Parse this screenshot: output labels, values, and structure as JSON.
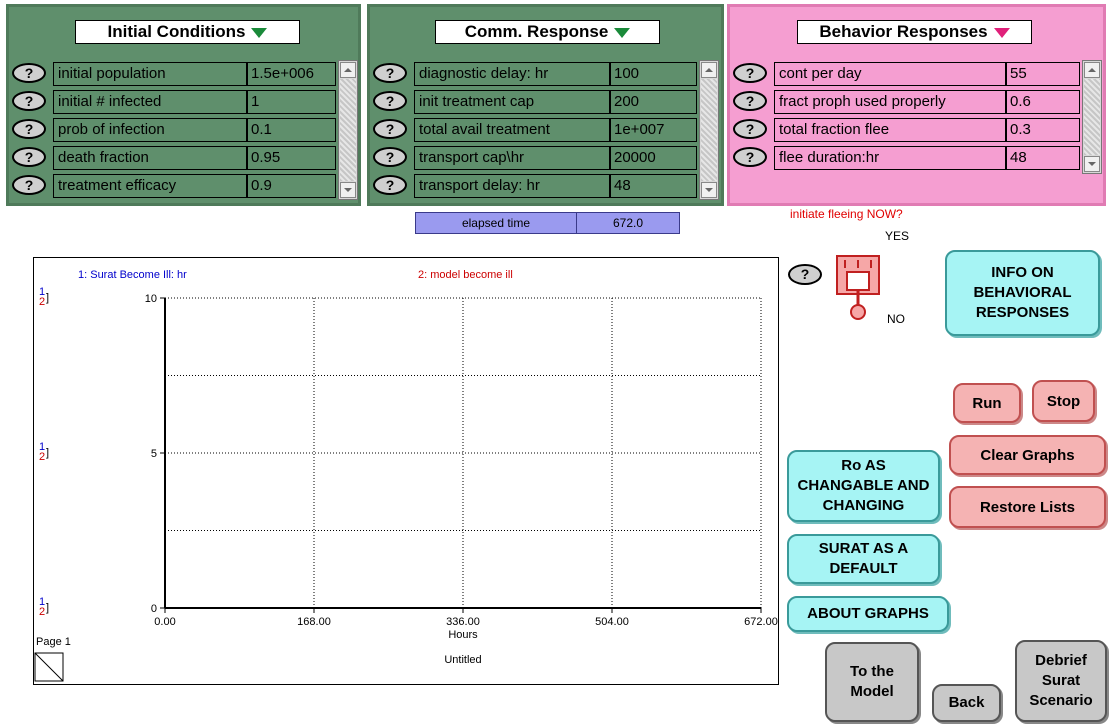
{
  "panels": {
    "initial": {
      "title": "Initial Conditions",
      "rows": [
        {
          "help": "?",
          "name": "initial population",
          "value": "1.5e+006"
        },
        {
          "help": "?",
          "name": "initial # infected",
          "value": "1"
        },
        {
          "help": "?",
          "name": "prob of infection",
          "value": "0.1"
        },
        {
          "help": "?",
          "name": "death fraction",
          "value": "0.95"
        },
        {
          "help": "?",
          "name": "treatment efficacy",
          "value": "0.9"
        }
      ]
    },
    "comm": {
      "title": "Comm. Response",
      "rows": [
        {
          "help": "?",
          "name": "diagnostic delay: hr",
          "value": "100"
        },
        {
          "help": "?",
          "name": "init treatment cap",
          "value": "200"
        },
        {
          "help": "?",
          "name": "total avail treatment",
          "value": "1e+007"
        },
        {
          "help": "?",
          "name": "transport cap\\hr",
          "value": "20000"
        },
        {
          "help": "?",
          "name": "transport delay: hr",
          "value": "48"
        }
      ]
    },
    "behavior": {
      "title": "Behavior Responses",
      "rows": [
        {
          "help": "?",
          "name": "cont per day",
          "value": "55"
        },
        {
          "help": "?",
          "name": "fract proph used properly",
          "value": "0.6"
        },
        {
          "help": "?",
          "name": "total fraction flee",
          "value": "0.3"
        },
        {
          "help": "?",
          "name": "flee duration:hr",
          "value": "48"
        }
      ]
    }
  },
  "elapsed": {
    "label": "elapsed time",
    "value": "672.0"
  },
  "graph": {
    "series1_label": "1: Surat Become Ill: hr",
    "series2_label": "2: model become ill",
    "axis_marker_1": "1",
    "axis_marker_2": "2",
    "xlabel": "Hours",
    "caption": "Untitled",
    "page_label": "Page 1",
    "x_ticks": [
      "0.00",
      "168.00",
      "336.00",
      "504.00",
      "672.00"
    ],
    "y_ticks": [
      "0",
      "5",
      "10"
    ],
    "colors": {
      "series1": "#0000cc",
      "series2": "#cc0000"
    }
  },
  "chart_data": {
    "type": "line",
    "title": "",
    "xlabel": "Hours",
    "ylabel": "",
    "xlim": [
      0,
      672
    ],
    "ylim": [
      0,
      10
    ],
    "x_ticks": [
      0,
      168,
      336,
      504,
      672
    ],
    "y_ticks": [
      0,
      5,
      10
    ],
    "grid": true,
    "series": [
      {
        "name": "1: Surat Become Ill: hr",
        "values": []
      },
      {
        "name": "2: model become ill",
        "values": []
      }
    ]
  },
  "flee": {
    "question": "initiate fleeing NOW?",
    "yes": "YES",
    "no": "NO",
    "help": "?"
  },
  "buttons": {
    "info": "INFO ON BEHAVIORAL RESPONSES",
    "run": "Run",
    "stop": "Stop",
    "clear_graphs": "Clear Graphs",
    "restore_lists": "Restore Lists",
    "ro": "Ro AS CHANGABLE AND CHANGING",
    "surat_default": "SURAT AS A DEFAULT",
    "about_graphs": "ABOUT GRAPHS",
    "to_model": "To the Model",
    "back": "Back",
    "debrief": "Debrief Surat Scenario"
  }
}
